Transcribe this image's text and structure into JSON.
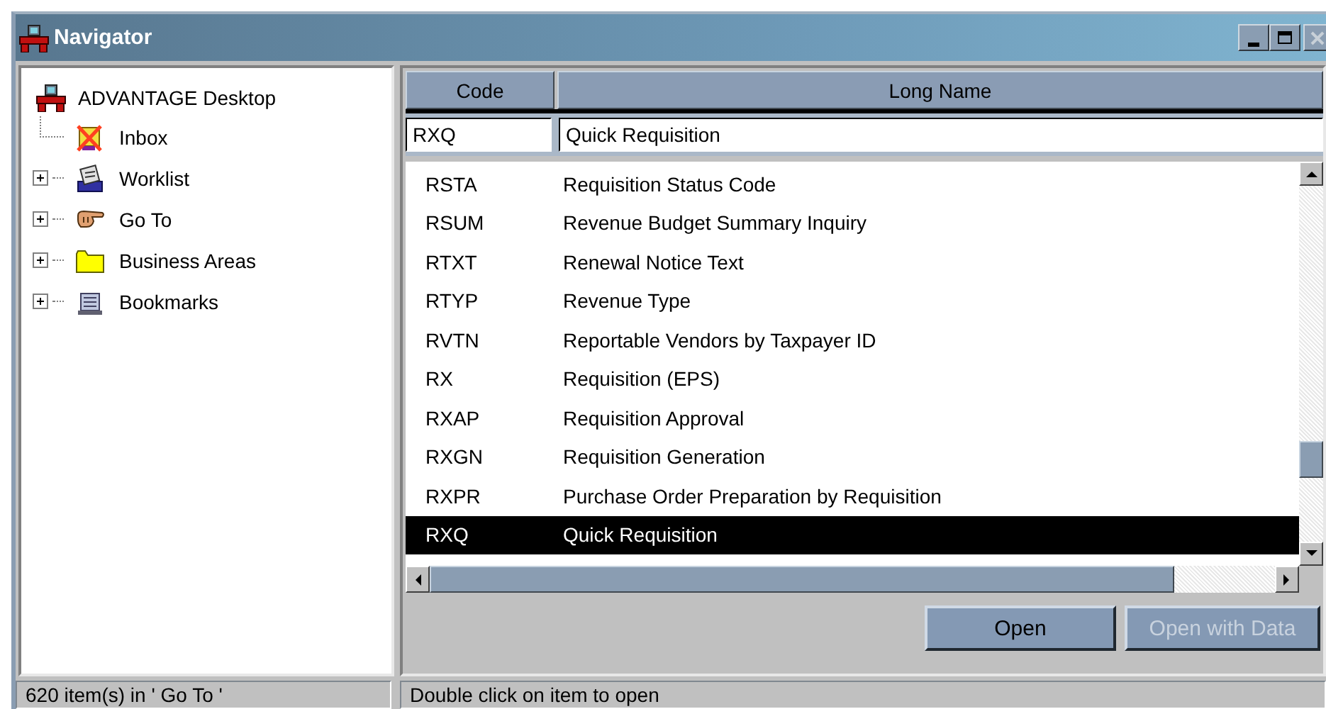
{
  "window": {
    "title": "Navigator"
  },
  "tree": {
    "label": "ADVANTAGE Desktop",
    "children": [
      {
        "label": "Inbox",
        "kind": "inbox"
      },
      {
        "label": "Worklist",
        "kind": "worklist",
        "expanded": false
      },
      {
        "label": "Go To",
        "kind": "goto",
        "expanded": false
      },
      {
        "label": "Business Areas",
        "kind": "folder",
        "expanded": false
      },
      {
        "label": "Bookmarks",
        "kind": "bookmarks",
        "expanded": false
      }
    ]
  },
  "table": {
    "columns": [
      "Code",
      "Long Name"
    ],
    "filter": {
      "code": "RXQ",
      "name": "Quick Requisition"
    },
    "rows": [
      {
        "code": "RSTA",
        "name": "Requisition Status Code",
        "selected": false
      },
      {
        "code": "RSUM",
        "name": "Revenue Budget Summary Inquiry",
        "selected": false
      },
      {
        "code": "RTXT",
        "name": "Renewal Notice Text",
        "selected": false
      },
      {
        "code": "RTYP",
        "name": "Revenue Type",
        "selected": false
      },
      {
        "code": "RVTN",
        "name": "Reportable Vendors by Taxpayer ID",
        "selected": false
      },
      {
        "code": "RX",
        "name": "Requisition (EPS)",
        "selected": false
      },
      {
        "code": "RXAP",
        "name": "Requisition Approval",
        "selected": false
      },
      {
        "code": "RXGN",
        "name": "Requisition Generation",
        "selected": false
      },
      {
        "code": "RXPR",
        "name": "Purchase Order Preparation by Requisition",
        "selected": false
      },
      {
        "code": "RXQ",
        "name": "Quick Requisition",
        "selected": true
      }
    ]
  },
  "buttons": [
    {
      "label": "Open",
      "disabled": false
    },
    {
      "label": "Open with Data",
      "disabled": true
    }
  ],
  "status_bar": [
    "620 item(s) in ' Go To '",
    "Double click on item to open"
  ]
}
